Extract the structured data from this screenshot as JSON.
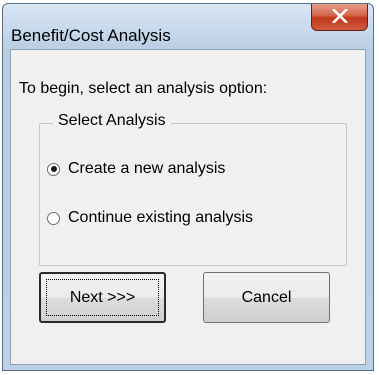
{
  "window": {
    "title": "Benefit/Cost Analysis",
    "close_icon": "close-x-icon"
  },
  "prompt": "To begin, select an analysis option:",
  "group": {
    "legend": "Select Analysis",
    "options": [
      {
        "label": "Create a new analysis",
        "selected": true
      },
      {
        "label": "Continue existing analysis",
        "selected": false
      }
    ]
  },
  "buttons": {
    "next_label": "Next >>>",
    "cancel_label": "Cancel"
  }
}
